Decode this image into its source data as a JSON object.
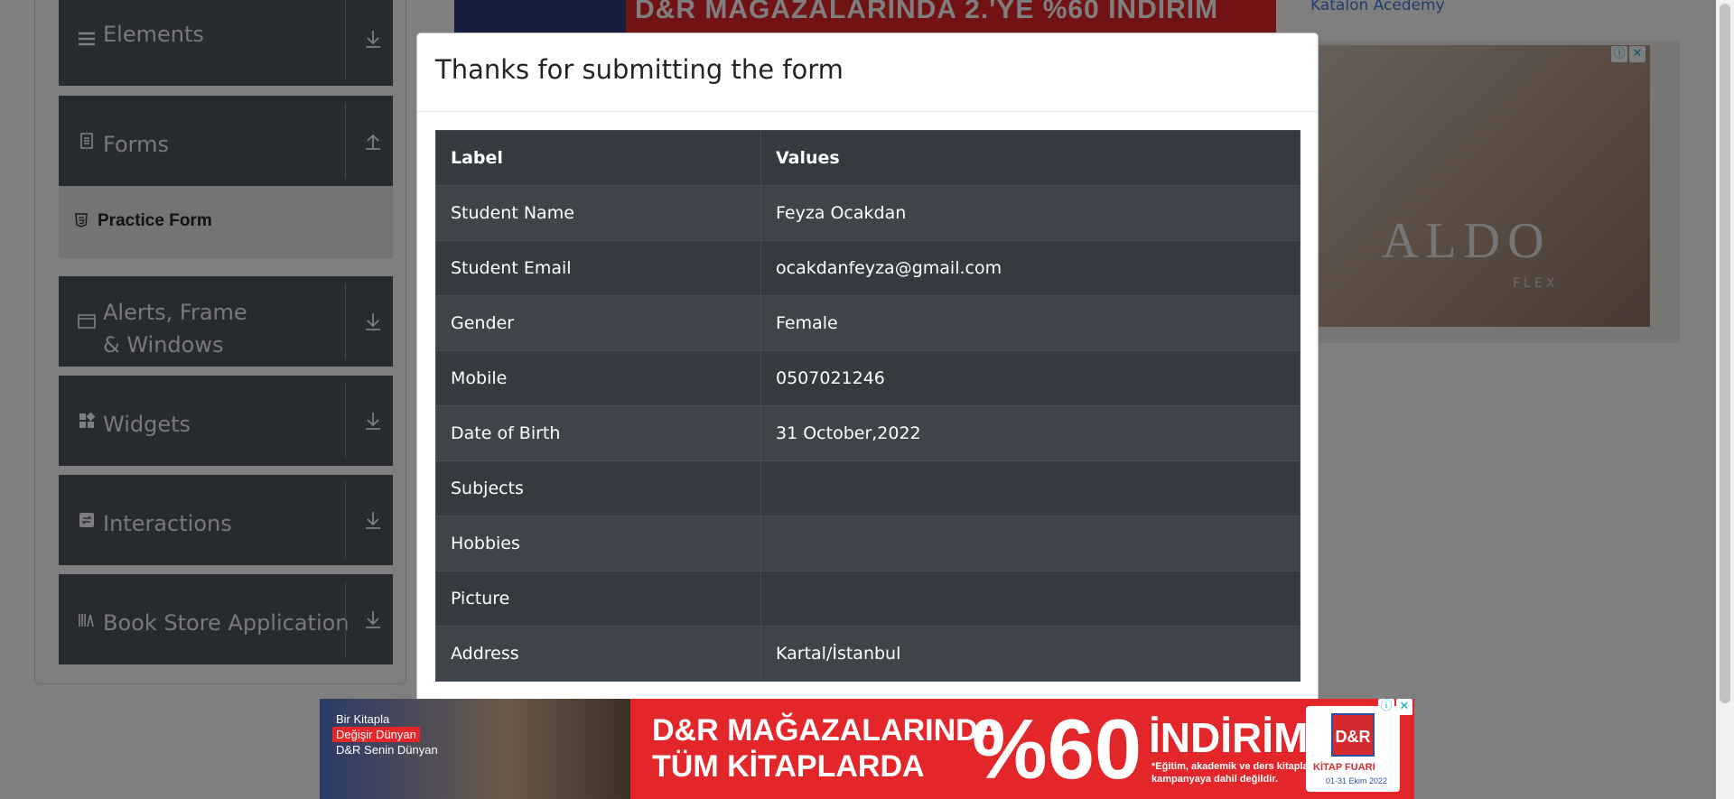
{
  "sidebar": {
    "groups": [
      {
        "label": "Elements",
        "icon": "hamburger-icon",
        "arrow": "download-arrow-icon"
      },
      {
        "label": "Forms",
        "icon": "document-icon",
        "arrow": "upload-arrow-icon"
      },
      {
        "label": "Alerts, Frame & Windows",
        "icon": "window-icon",
        "arrow": "download-arrow-icon"
      },
      {
        "label": "Widgets",
        "icon": "widgets-icon",
        "arrow": "download-arrow-icon"
      },
      {
        "label": "Interactions",
        "icon": "interactions-icon",
        "arrow": "download-arrow-icon"
      },
      {
        "label": "Book Store Application",
        "icon": "books-icon",
        "arrow": "download-arrow-icon"
      }
    ],
    "active_item": {
      "label": "Practice Form",
      "icon": "html5-icon"
    }
  },
  "top_ad": {
    "text": "D&R MAĞAZALARINDA 2.'YE %60 İNDİRİM"
  },
  "side_link": "Katalon Acedemy",
  "side_ad": {
    "brand": "ALDO",
    "sub": "FLEX"
  },
  "modal": {
    "title": "Thanks for submitting the form",
    "table": {
      "headers": [
        "Label",
        "Values"
      ],
      "rows": [
        [
          "Student Name",
          "Feyza Ocakdan"
        ],
        [
          "Student Email",
          "ocakdanfeyza@gmail.com"
        ],
        [
          "Gender",
          "Female"
        ],
        [
          "Mobile",
          "0507021246"
        ],
        [
          "Date of Birth",
          "31 October,2022"
        ],
        [
          "Subjects",
          ""
        ],
        [
          "Hobbies",
          ""
        ],
        [
          "Picture",
          ""
        ],
        [
          "Address",
          "Kartal/İstanbul"
        ]
      ]
    }
  },
  "bottom_ad": {
    "tagline": [
      "Bir Kitapla",
      "Değişir Dünyan",
      "D&R Senin Dünyan"
    ],
    "line1": "D&R MAĞAZALARINDA",
    "line2": "TÜM KİTAPLARDA",
    "discount": "%60",
    "sale": "İNDİRİM",
    "note": "*Eğitim, akademik ve ders kitapları kampanyaya dahil değildir.",
    "logo": "D&R",
    "fair": "KİTAP FUARI",
    "dates": "01-31 Ekim 2022"
  },
  "colors": {
    "sidebar_group": "#4f555c",
    "table_dark": "#343a40",
    "ad_red": "#e3262a",
    "overlay": "rgba(0,0,0,0.5)"
  }
}
